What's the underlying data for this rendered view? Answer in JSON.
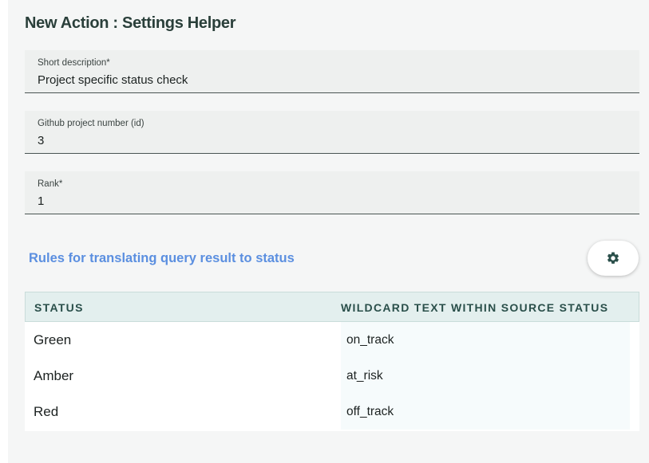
{
  "header": {
    "title": "New Action : Settings Helper"
  },
  "form": {
    "short_description": {
      "label": "Short description*",
      "value": "Project specific status check"
    },
    "github_project_number": {
      "label": "Github project number (id)",
      "value": "3"
    },
    "rank": {
      "label": "Rank*",
      "value": "1"
    }
  },
  "rules": {
    "title": "Rules for translating query result to status",
    "settings_icon": "gear-icon",
    "columns": [
      "STATUS",
      "WILDCARD TEXT WITHIN SOURCE STATUS"
    ],
    "rows": [
      {
        "status": "Green",
        "wildcard": "on_track"
      },
      {
        "status": "Amber",
        "wildcard": "at_risk"
      },
      {
        "status": "Red",
        "wildcard": "off_track"
      }
    ]
  },
  "colors": {
    "accent": "#5b8fe0",
    "title": "#2a3f3a",
    "table_header_bg": "#e3efee",
    "panel_bg": "#f5f6f6"
  }
}
